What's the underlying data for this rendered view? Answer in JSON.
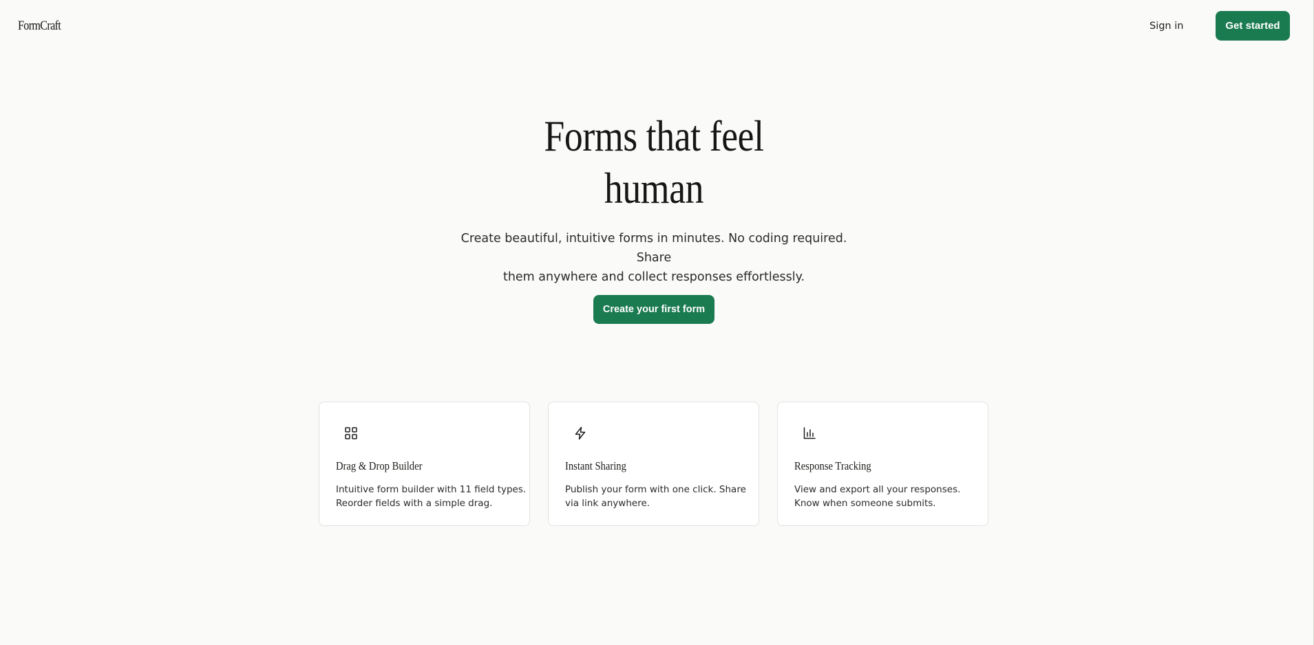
{
  "header": {
    "logo": "FormCraft",
    "sign_in_label": "Sign in",
    "get_started_label": "Get started"
  },
  "hero": {
    "title_lines": [
      "Forms that feel",
      "human"
    ],
    "subtitle_lines": [
      "Create beautiful, intuitive forms in minutes. No coding required. Share",
      "them anywhere and collect responses effortlessly."
    ],
    "cta_label": "Create your first form"
  },
  "features": [
    {
      "icon": "grid-icon",
      "title": "Drag & Drop Builder",
      "description_lines": [
        "Intuitive form builder with 11 field types.",
        "Reorder fields with a simple drag."
      ]
    },
    {
      "icon": "lightning-icon",
      "title": "Instant Sharing",
      "description_lines": [
        "Publish your form with one click. Share",
        "via link anywhere."
      ]
    },
    {
      "icon": "bar-chart-icon",
      "title": "Response Tracking",
      "description_lines": [
        "View and export all your responses.",
        "Know when someone submits."
      ]
    }
  ],
  "colors": {
    "accent": "#1a7a50",
    "background": "#fafaf9",
    "text": "#1c1c1a"
  }
}
